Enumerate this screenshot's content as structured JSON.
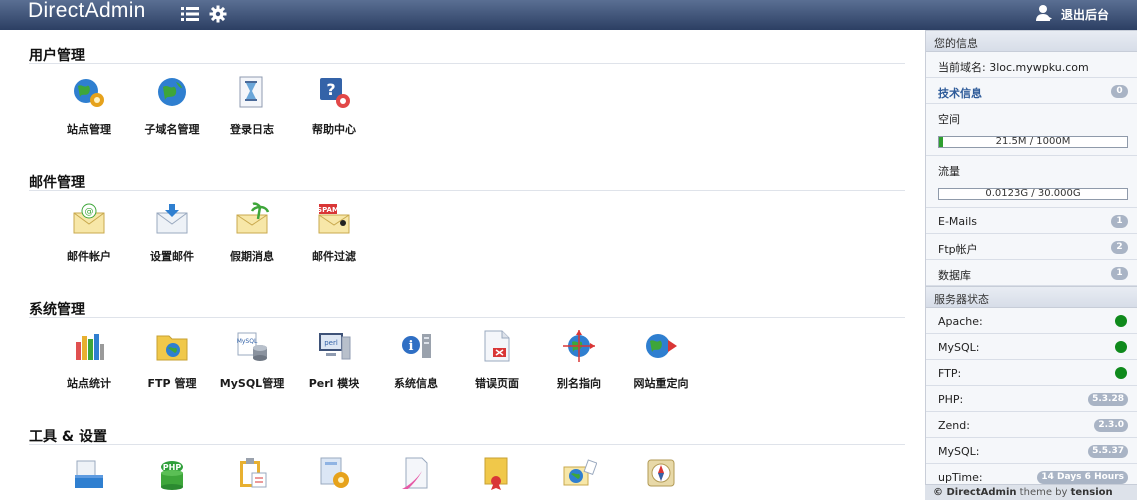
{
  "header": {
    "brand": "DirectAdmin",
    "logout_label": "退出后台"
  },
  "sections": [
    {
      "title": "用户管理",
      "items": [
        {
          "label": "站点管理",
          "icon": "globe-gear-icon"
        },
        {
          "label": "子域名管理",
          "icon": "globe-icon"
        },
        {
          "label": "登录日志",
          "icon": "hourglass-doc-icon"
        },
        {
          "label": "帮助中心",
          "icon": "help-lifebuoy-icon"
        }
      ]
    },
    {
      "title": "邮件管理",
      "items": [
        {
          "label": "邮件帐户",
          "icon": "mail-at-icon"
        },
        {
          "label": "设置邮件",
          "icon": "mail-download-icon"
        },
        {
          "label": "假期消息",
          "icon": "mail-palm-icon"
        },
        {
          "label": "邮件过滤",
          "icon": "mail-spam-icon"
        }
      ]
    },
    {
      "title": "系统管理",
      "items": [
        {
          "label": "站点统计",
          "icon": "bar-stats-icon"
        },
        {
          "label": "FTP 管理",
          "icon": "ftp-folder-icon"
        },
        {
          "label": "MySQL管理",
          "icon": "mysql-database-icon"
        },
        {
          "label": "Perl 模块",
          "icon": "perl-monitor-icon"
        },
        {
          "label": "系统信息",
          "icon": "info-icon"
        },
        {
          "label": "错误页面",
          "icon": "error-page-icon"
        },
        {
          "label": "别名指向",
          "icon": "alias-pointer-icon"
        },
        {
          "label": "网站重定向",
          "icon": "redirect-globe-icon"
        }
      ]
    },
    {
      "title": "工具 & 设置",
      "items": [
        {
          "label": "",
          "icon": "tools-box-icon"
        },
        {
          "label": "",
          "icon": "php-stack-icon"
        },
        {
          "label": "",
          "icon": "clipboard-icon"
        },
        {
          "label": "",
          "icon": "doc-gear-icon"
        },
        {
          "label": "",
          "icon": "feather-doc-icon"
        },
        {
          "label": "",
          "icon": "certificate-icon"
        },
        {
          "label": "",
          "icon": "mail-globe-icon"
        },
        {
          "label": "",
          "icon": "compass-icon"
        }
      ]
    }
  ],
  "sidebar": {
    "info_title": "您的信息",
    "domain_label": "当前域名:",
    "domain_value": "3loc.mywpku.com",
    "tech_label": "技术信息",
    "tech_count": "0",
    "space_label": "空间",
    "space_text": "21.5M / 1000M",
    "space_fraction": 0.0215,
    "traffic_label": "流量",
    "traffic_text": "0.0123G / 30.000G",
    "traffic_fraction": 0.0004,
    "emails_label": "E-Mails",
    "emails_count": "1",
    "ftp_label": "Ftp帐户",
    "ftp_count": "2",
    "db_label": "数据库",
    "db_count": "1",
    "server_title": "服务器状态",
    "apache_label": "Apache:",
    "mysql_status_label": "MySQL:",
    "ftp_status_label": "FTP:",
    "php_label": "PHP:",
    "php_version": "5.3.28",
    "zend_label": "Zend:",
    "zend_version": "2.3.0",
    "mysql_label": "MySQL:",
    "mysql_version": "5.5.37",
    "uptime_label": "upTime:",
    "uptime_value": "14 Days 6 Hours"
  },
  "footer": {
    "copy": "© DirectAdmin",
    "mid": " theme by ",
    "author": "tension"
  },
  "colors": {
    "status_green": "#0f8a1c",
    "link_blue": "#2e5b99"
  }
}
